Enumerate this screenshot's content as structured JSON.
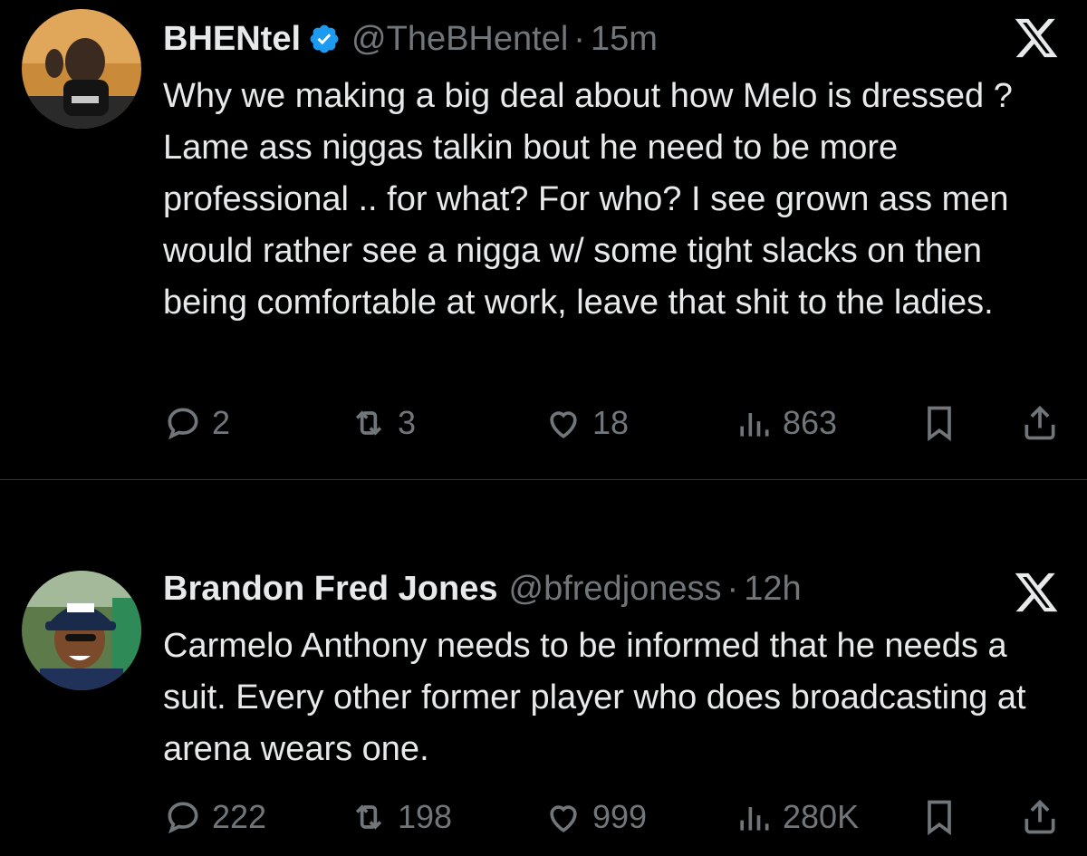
{
  "colors": {
    "background": "#000000",
    "text": "#e7e9ea",
    "muted": "#71767b",
    "verified": "#1d9bf0",
    "divider": "#2f3336"
  },
  "tweets": [
    {
      "name": "BHENtel",
      "verified": true,
      "handle": "@TheBHentel",
      "separator": "·",
      "time": "15m",
      "text": "Why we making a big deal about how Melo is dressed ? Lame ass niggas talkin bout he need to be more professional .. for what? For who? I see grown ass men would rather see a nigga w/ some tight slacks on then being comfortable at work, leave that shit to the ladies.",
      "replies": "2",
      "reposts": "3",
      "likes": "18",
      "views": "863"
    },
    {
      "name": "Brandon Fred Jones",
      "verified": false,
      "handle": "@bfredjoness",
      "separator": "·",
      "time": "12h",
      "text": "Carmelo Anthony needs to be informed that he needs a suit. Every other former player who does broadcasting at arena wears one.",
      "replies": "222",
      "reposts": "198",
      "likes": "999",
      "views": "280K"
    }
  ],
  "icons": [
    "x-logo-icon",
    "verified-badge-icon",
    "reply-icon",
    "repost-icon",
    "like-icon",
    "views-icon",
    "bookmark-icon",
    "share-icon"
  ]
}
